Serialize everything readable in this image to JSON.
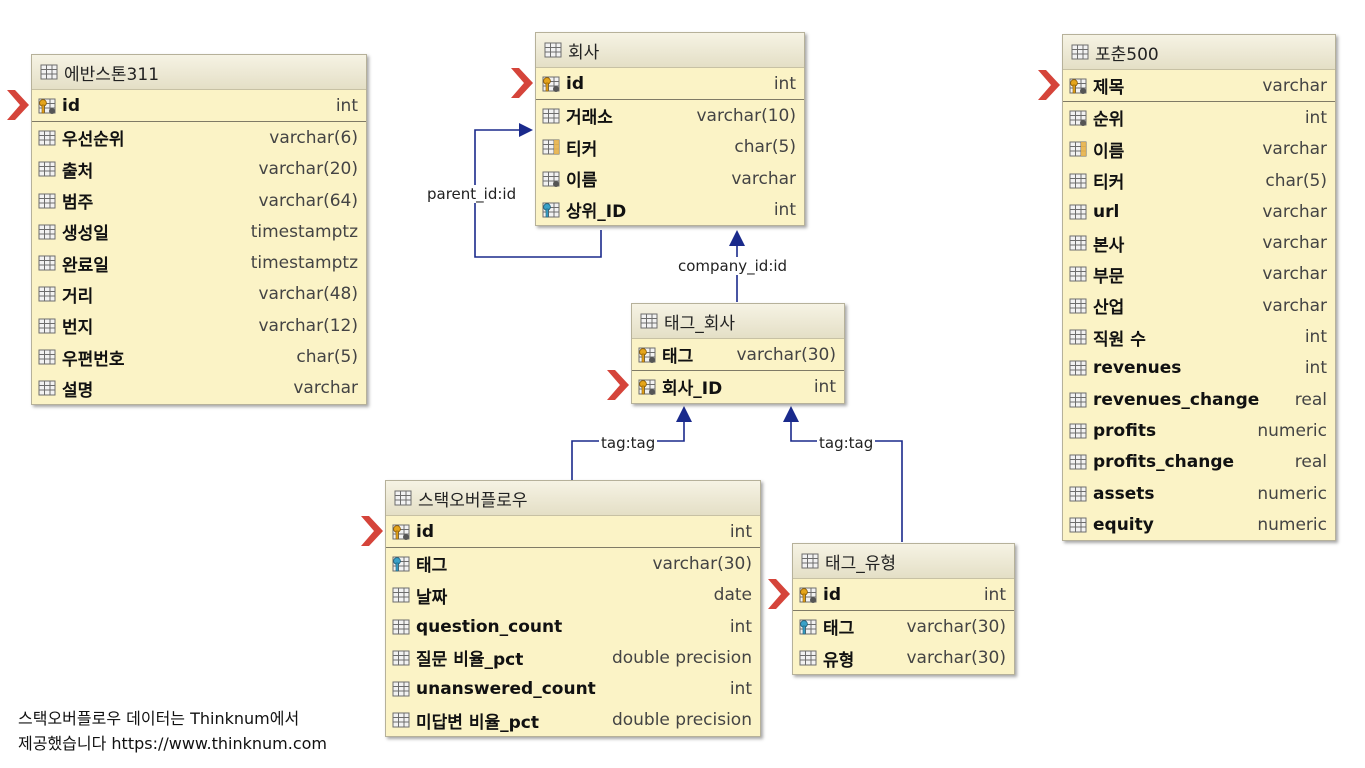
{
  "tables": [
    {
      "key": "evanston",
      "title": "에반스톤311",
      "columns": [
        {
          "name": "id",
          "type": "int",
          "icon": "primary-key-icon",
          "pk": true
        },
        {
          "name": "우선순위",
          "type": "varchar(6)",
          "icon": "column-icon"
        },
        {
          "name": "출처",
          "type": "varchar(20)",
          "icon": "column-icon"
        },
        {
          "name": "범주",
          "type": "varchar(64)",
          "icon": "column-icon"
        },
        {
          "name": "생성일",
          "type": "timestamptz",
          "icon": "column-icon"
        },
        {
          "name": "완료일",
          "type": "timestamptz",
          "icon": "column-icon"
        },
        {
          "name": "거리",
          "type": "varchar(48)",
          "icon": "column-icon"
        },
        {
          "name": "번지",
          "type": "varchar(12)",
          "icon": "column-icon"
        },
        {
          "name": "우편번호",
          "type": "char(5)",
          "icon": "column-icon"
        },
        {
          "name": "설명",
          "type": "varchar",
          "icon": "column-icon"
        }
      ]
    },
    {
      "key": "company",
      "title": "회사",
      "columns": [
        {
          "name": "id",
          "type": "int",
          "icon": "primary-key-icon",
          "pk": true
        },
        {
          "name": "거래소",
          "type": "varchar(10)",
          "icon": "column-icon"
        },
        {
          "name": "티커",
          "type": "char(5)",
          "icon": "indexed-column-icon"
        },
        {
          "name": "이름",
          "type": "varchar",
          "icon": "not-null-column-icon"
        },
        {
          "name": "상위_ID",
          "type": "int",
          "icon": "foreign-key-icon"
        }
      ]
    },
    {
      "key": "fortune",
      "title": "포춘500",
      "columns": [
        {
          "name": "제목",
          "type": "varchar",
          "icon": "primary-key-icon",
          "pk": true
        },
        {
          "name": "순위",
          "type": "int",
          "icon": "not-null-column-icon"
        },
        {
          "name": "이름",
          "type": "varchar",
          "icon": "indexed-column-icon"
        },
        {
          "name": "티커",
          "type": "char(5)",
          "icon": "column-icon"
        },
        {
          "name": "url",
          "type": "varchar",
          "icon": "column-icon"
        },
        {
          "name": "본사",
          "type": "varchar",
          "icon": "column-icon"
        },
        {
          "name": "부문",
          "type": "varchar",
          "icon": "column-icon"
        },
        {
          "name": "산업",
          "type": "varchar",
          "icon": "column-icon"
        },
        {
          "name": "직원 수",
          "type": "int",
          "icon": "column-icon"
        },
        {
          "name": "revenues",
          "type": "int",
          "icon": "column-icon"
        },
        {
          "name": "revenues_change",
          "type": "real",
          "icon": "column-icon"
        },
        {
          "name": "profits",
          "type": "numeric",
          "icon": "column-icon"
        },
        {
          "name": "profits_change",
          "type": "real",
          "icon": "column-icon"
        },
        {
          "name": "assets",
          "type": "numeric",
          "icon": "column-icon"
        },
        {
          "name": "equity",
          "type": "numeric",
          "icon": "column-icon"
        }
      ]
    },
    {
      "key": "tag_company",
      "title": "태그_회사",
      "columns": [
        {
          "name": "태그",
          "type": "varchar(30)",
          "icon": "primary-key-icon"
        },
        {
          "name": "회사_ID",
          "type": "int",
          "icon": "primary-key-icon",
          "pk": true,
          "marker": true
        }
      ]
    },
    {
      "key": "stackoverflow",
      "title": "스택오버플로우",
      "columns": [
        {
          "name": "id",
          "type": "int",
          "icon": "primary-key-icon",
          "pk": true
        },
        {
          "name": "태그",
          "type": "varchar(30)",
          "icon": "foreign-key-icon"
        },
        {
          "name": "날짜",
          "type": "date",
          "icon": "column-icon"
        },
        {
          "name": "question_count",
          "type": "int",
          "icon": "column-icon"
        },
        {
          "name": "질문 비율_pct",
          "type": "double precision",
          "icon": "column-icon"
        },
        {
          "name": "unanswered_count",
          "type": "int",
          "icon": "column-icon"
        },
        {
          "name": "미답변 비율_pct",
          "type": "double precision",
          "icon": "column-icon"
        }
      ]
    },
    {
      "key": "tag_type",
      "title": "태그_유형",
      "columns": [
        {
          "name": "id",
          "type": "int",
          "icon": "primary-key-icon",
          "pk": true
        },
        {
          "name": "태그",
          "type": "varchar(30)",
          "icon": "foreign-key-icon"
        },
        {
          "name": "유형",
          "type": "varchar(30)",
          "icon": "column-icon"
        }
      ]
    }
  ],
  "relations": [
    {
      "label": "parent_id:id"
    },
    {
      "label": "company_id:id"
    },
    {
      "label": "tag:tag"
    },
    {
      "label": "tag:tag"
    }
  ],
  "footnote": {
    "line1": "스택오버플로우 데이터는 Thinknum에서",
    "line2": "제공했습니다 https://www.thinknum.com"
  },
  "colors": {
    "table_bg": "#fbf3c6",
    "header_bg": "#e9e5cf",
    "connector": "#1a2a8c",
    "marker": "#d5443a"
  }
}
